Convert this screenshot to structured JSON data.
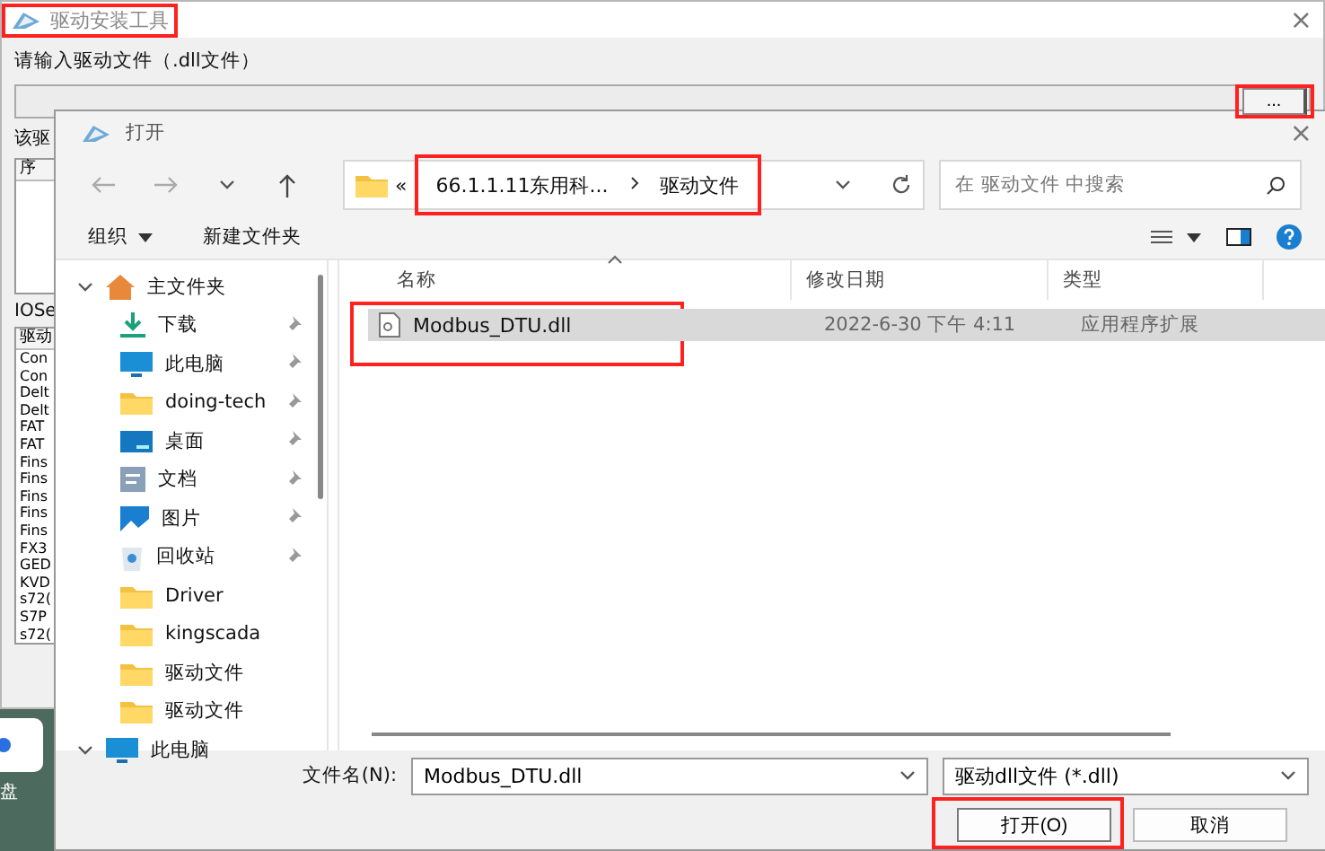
{
  "main_window": {
    "title": "驱动安装工具",
    "title_highlighted": true,
    "close": "×",
    "prompt": "请输入驱动文件（.dll文件）",
    "browse_button": {
      "label": "...",
      "highlighted": true
    },
    "driver_label": "该驱",
    "table_header": "序",
    "ioserver_label": "IOSe",
    "driver_list": {
      "header": "驱动",
      "items": [
        "Con",
        "Con",
        "Delt",
        "Delt",
        "FAT",
        "FAT",
        "Fins",
        "Fins",
        "Fins",
        "Fins",
        "Fins",
        "FX3",
        "GED",
        "KVD",
        "s72(",
        "S7P",
        "s72("
      ]
    }
  },
  "desktop": {
    "icon_label": "盘"
  },
  "dialog": {
    "title": "打开",
    "close": "×",
    "overflow": "«",
    "breadcrumb": {
      "highlighted": true,
      "parts": [
        "66.1.1.11东用科...",
        "驱动文件"
      ]
    },
    "search": {
      "placeholder": "在 驱动文件 中搜索"
    },
    "toolbar": {
      "organize": "组织",
      "new_folder": "新建文件夹"
    },
    "sidebar": [
      {
        "label": "主文件夹",
        "kind": "home",
        "expanded": true,
        "children": [
          {
            "label": "下载",
            "kind": "download",
            "pinned": true
          },
          {
            "label": "此电脑",
            "kind": "computer",
            "pinned": true
          },
          {
            "label": "doing-tech",
            "kind": "folder",
            "pinned": true
          },
          {
            "label": "桌面",
            "kind": "desktop",
            "pinned": true
          },
          {
            "label": "文档",
            "kind": "document",
            "pinned": true
          },
          {
            "label": "图片",
            "kind": "image",
            "pinned": true
          },
          {
            "label": "回收站",
            "kind": "bin",
            "pinned": true
          },
          {
            "label": "Driver",
            "kind": "folder",
            "pinned": false
          },
          {
            "label": "kingscada",
            "kind": "folder",
            "pinned": false
          },
          {
            "label": "驱动文件",
            "kind": "folder",
            "pinned": false
          },
          {
            "label": "驱动文件",
            "kind": "folder",
            "pinned": false
          }
        ]
      },
      {
        "label": "此电脑",
        "kind": "computer",
        "expanded": true
      }
    ],
    "columns": [
      "名称",
      "修改日期",
      "类型"
    ],
    "files": [
      {
        "name": "Modbus_DTU.dll",
        "date": "2022-6-30 下午 4:11",
        "type": "应用程序扩展",
        "selected": true,
        "highlighted": true
      }
    ],
    "file_name_label": "文件名(N):",
    "file_name": "Modbus_DTU.dll",
    "file_type": "驱动dll文件 (*.dll)",
    "buttons": [
      {
        "label": "打开(O)",
        "primary": true,
        "highlighted": true
      },
      {
        "label": "取消",
        "primary": false,
        "highlighted": false
      }
    ]
  }
}
